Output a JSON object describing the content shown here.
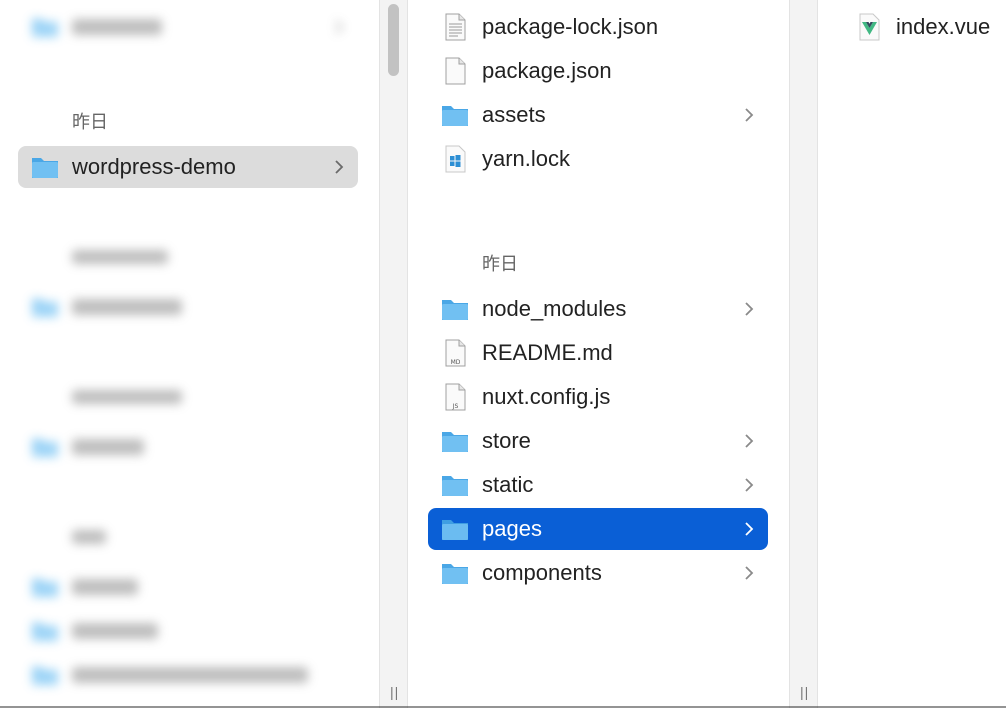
{
  "colors": {
    "selection_blue": "#0a5fd6",
    "selection_gray": "#dcdcdc",
    "folder_blue": "#5ab4ee"
  },
  "column1": {
    "top_item": {
      "label": "下载项目",
      "icon": "folder-icon"
    },
    "section_yesterday": "昨日",
    "selected_item": {
      "label": "wordpress-demo",
      "icon": "folder-icon"
    },
    "section_prev7": "过去7日间",
    "item_vue_demo": {
      "label": "vue-demo",
      "icon": "folder-icon"
    },
    "section_prev30": "过去30日间",
    "item_laravel": {
      "label": "laravel",
      "icon": "folder-icon"
    },
    "section_month": "五月",
    "item_webgl": {
      "label": "webgl",
      "icon": "folder-icon"
    },
    "item_corders": {
      "label": "corders",
      "icon": "folder-icon"
    },
    "item_docker": {
      "label": "codelike_web_docker",
      "icon": "folder-icon"
    }
  },
  "column2": {
    "items_top": [
      {
        "label": "package-lock.json",
        "icon": "json-file-icon",
        "folder": false
      },
      {
        "label": "package.json",
        "icon": "file-icon",
        "folder": false
      },
      {
        "label": "assets",
        "icon": "folder-icon",
        "folder": true
      },
      {
        "label": "yarn.lock",
        "icon": "lock-file-icon",
        "folder": false
      }
    ],
    "section_yesterday": "昨日",
    "items_bottom": [
      {
        "label": "node_modules",
        "icon": "folder-icon",
        "folder": true
      },
      {
        "label": "README.md",
        "icon": "md-file-icon",
        "folder": false,
        "badge": "MD"
      },
      {
        "label": "nuxt.config.js",
        "icon": "js-file-icon",
        "folder": false,
        "badge": "JS"
      },
      {
        "label": "store",
        "icon": "folder-icon",
        "folder": true
      },
      {
        "label": "static",
        "icon": "folder-icon",
        "folder": true
      },
      {
        "label": "pages",
        "icon": "folder-icon",
        "folder": true,
        "selected": true
      },
      {
        "label": "components",
        "icon": "folder-icon",
        "folder": true
      }
    ]
  },
  "column3": {
    "items": [
      {
        "label": "index.vue",
        "icon": "vue-file-icon"
      }
    ]
  },
  "resize_glyph": "||"
}
